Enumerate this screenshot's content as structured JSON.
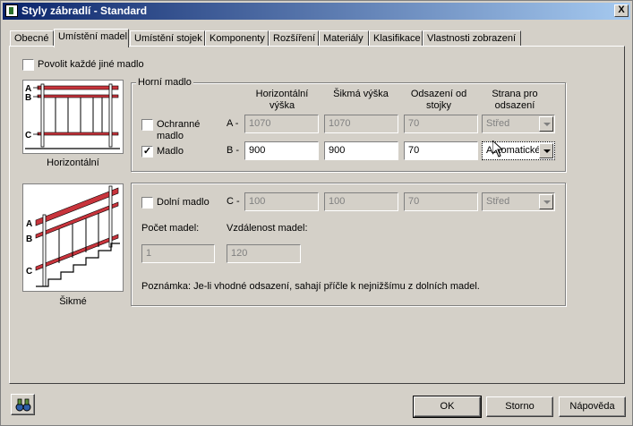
{
  "window": {
    "title": "Styly zábradlí - Standard",
    "close_label": "X"
  },
  "tabs": [
    {
      "label": "Obecné"
    },
    {
      "label": "Umístění madel"
    },
    {
      "label": "Umístění stojek"
    },
    {
      "label": "Komponenty"
    },
    {
      "label": "Rozšíření"
    },
    {
      "label": "Materiály"
    },
    {
      "label": "Klasifikace"
    },
    {
      "label": "Vlastnosti zobrazení"
    }
  ],
  "allow_each_other": {
    "label": "Povolit každé jiné madlo",
    "checked": false
  },
  "diagrams": {
    "horizontal_caption": "Horizontální",
    "slope_caption": "Šikmé",
    "marks": [
      "A",
      "B",
      "C"
    ]
  },
  "top_group": {
    "title": "Horní madlo",
    "col_headers": [
      "Horizontální\nvýška",
      "Šikmá výška",
      "Odsazení od\nstojky",
      "Strana pro\nodsazení"
    ],
    "rows": [
      {
        "check_label": "Ochranné\nmadlo",
        "checked": false,
        "row_label": "A -",
        "values": [
          "1070",
          "1070",
          "70"
        ],
        "side": "Střed",
        "enabled": false
      },
      {
        "check_label": "Madlo",
        "checked": true,
        "row_label": "B -",
        "values": [
          "900",
          "900",
          "70"
        ],
        "side": "Automatické",
        "enabled": true
      }
    ]
  },
  "bottom_group": {
    "check_label": "Dolní madlo",
    "checked": false,
    "row_label": "C -",
    "values": [
      "100",
      "100",
      "70"
    ],
    "side": "Střed",
    "count_label": "Počet madel:",
    "count_value": "1",
    "spacing_label": "Vzdálenost madel:",
    "spacing_value": "120",
    "note": "Poznámka: Je-li vhodné odsazení, sahají příčle k nejnižšímu z dolních madel."
  },
  "buttons": {
    "ok": "OK",
    "cancel": "Storno",
    "help": "Nápověda"
  },
  "colors": {
    "rail_red": "#c8343c",
    "title_blue": "#0a246a"
  }
}
